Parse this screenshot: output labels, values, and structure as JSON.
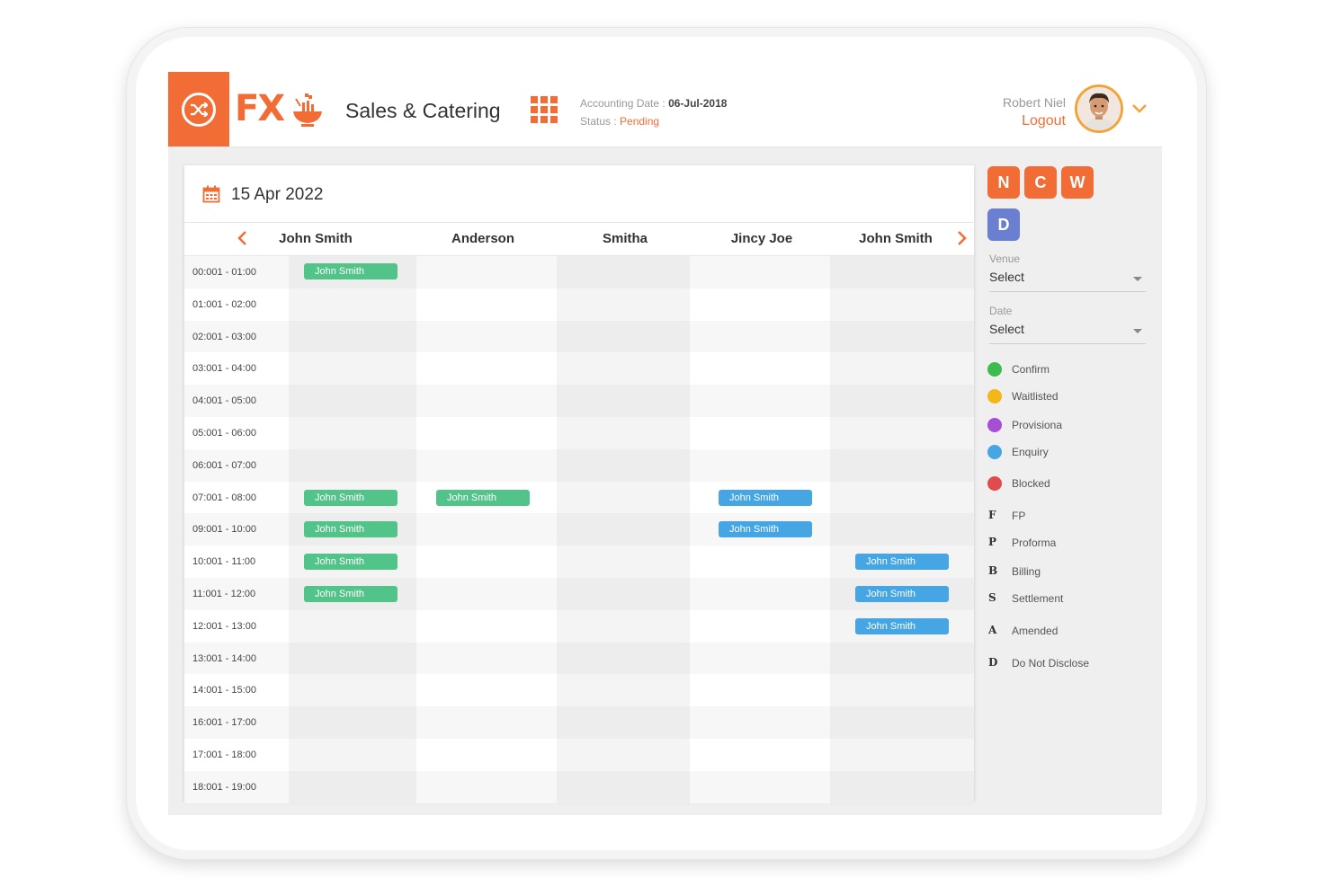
{
  "header": {
    "menu_icon": "shuffle-icon",
    "logo_text": "FX",
    "app_title": "Sales & Catering",
    "accounting_date_label": "Accounting Date :",
    "accounting_date_value": "06-Jul-2018",
    "status_label": "Status :",
    "status_value": "Pending",
    "user_name": "Robert Niel",
    "logout_label": "Logout",
    "accent_color": "#f26d35"
  },
  "calendar": {
    "date": "15 Apr 2022",
    "columns": [
      "John Smith",
      "Anderson",
      "Smitha",
      "Jincy Joe",
      "John Smith"
    ],
    "time_slots": [
      "00:001 - 01:00",
      "01:001 - 02:00",
      "02:001 - 03:00",
      "03:001 - 04:00",
      "04:001 - 05:00",
      "05:001 - 06:00",
      "06:001 - 07:00",
      "07:001 - 08:00",
      "09:001 - 10:00",
      "10:001 - 11:00",
      "11:001 - 12:00",
      "12:001 - 13:00",
      "13:001 - 14:00",
      "14:001 - 15:00",
      "16:001 - 17:00",
      "17:001 - 18:00",
      "18:001 - 19:00"
    ],
    "events": [
      {
        "row": 0,
        "col": 0,
        "label": "John Smith",
        "status": "Confirm"
      },
      {
        "row": 7,
        "col": 0,
        "label": "John Smith",
        "status": "Confirm"
      },
      {
        "row": 7,
        "col": 1,
        "label": "John Smith",
        "status": "Confirm"
      },
      {
        "row": 7,
        "col": 3,
        "label": "John Smith",
        "status": "Enquiry"
      },
      {
        "row": 8,
        "col": 0,
        "label": "John Smith",
        "status": "Confirm"
      },
      {
        "row": 8,
        "col": 3,
        "label": "John Smith",
        "status": "Enquiry"
      },
      {
        "row": 9,
        "col": 0,
        "label": "John Smith",
        "status": "Confirm"
      },
      {
        "row": 9,
        "col": 4,
        "label": "John Smith",
        "status": "Enquiry"
      },
      {
        "row": 10,
        "col": 0,
        "label": "John Smith",
        "status": "Confirm"
      },
      {
        "row": 10,
        "col": 4,
        "label": "John Smith",
        "status": "Enquiry"
      },
      {
        "row": 11,
        "col": 4,
        "label": "John Smith",
        "status": "Enquiry"
      }
    ]
  },
  "side_panel": {
    "view_buttons": [
      "N",
      "C",
      "W",
      "D"
    ],
    "venue_label": "Venue",
    "venue_value": "Select",
    "date_label": "Date",
    "date_value": "Select",
    "status_legend": [
      {
        "label": "Confirm",
        "color": "#3dbb4f"
      },
      {
        "label": "Waitlisted",
        "color": "#f2b81a"
      },
      {
        "label": "Provisiona",
        "color": "#a64fd4"
      },
      {
        "label": "Enquiry",
        "color": "#45a6e3"
      },
      {
        "label": "Blocked",
        "color": "#e04b4b"
      }
    ],
    "code_legend": [
      {
        "letter": "F",
        "label": "FP"
      },
      {
        "letter": "P",
        "label": "Proforma"
      },
      {
        "letter": "B",
        "label": "Billing"
      },
      {
        "letter": "S",
        "label": "Settlement"
      },
      {
        "letter": "A",
        "label": "Amended"
      },
      {
        "letter": "D",
        "label": "Do Not Disclose"
      }
    ]
  }
}
